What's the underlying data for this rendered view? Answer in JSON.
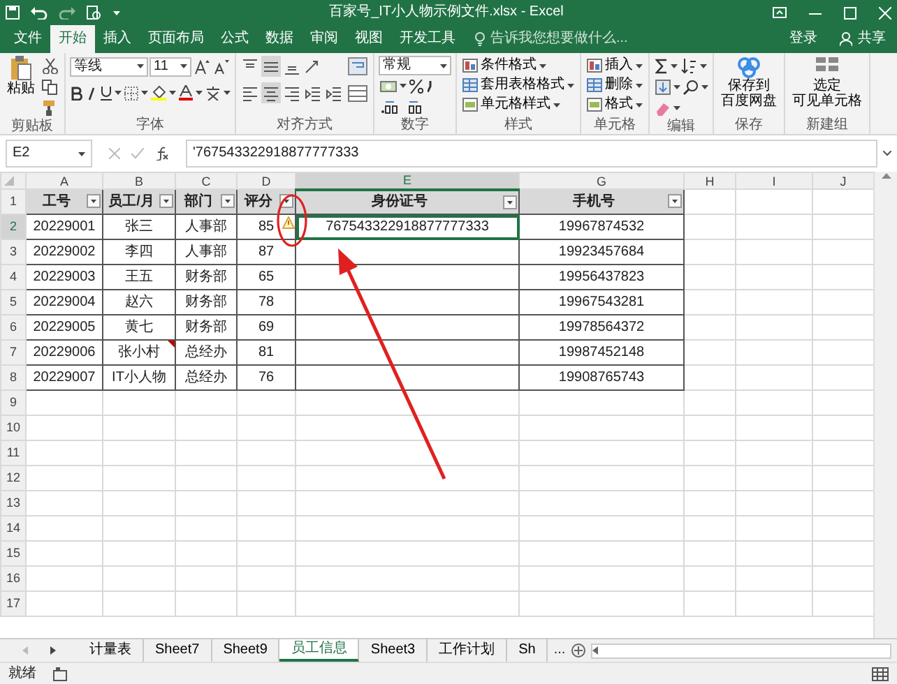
{
  "window": {
    "title": "百家号_IT小人物示例文件.xlsx - Excel"
  },
  "ribbon_tabs": [
    {
      "label": "文件",
      "selected": false
    },
    {
      "label": "开始",
      "selected": true
    },
    {
      "label": "插入",
      "selected": false
    },
    {
      "label": "页面布局",
      "selected": false
    },
    {
      "label": "公式",
      "selected": false
    },
    {
      "label": "数据",
      "selected": false
    },
    {
      "label": "审阅",
      "selected": false
    },
    {
      "label": "视图",
      "selected": false
    },
    {
      "label": "开发工具",
      "selected": false
    }
  ],
  "tell_me": {
    "placeholder": "告诉我您想要做什么..."
  },
  "account": {
    "login": "登录",
    "share": "共享"
  },
  "ribbon_groups": [
    {
      "label": "剪贴板",
      "kind": "clipboard",
      "paste": "粘贴"
    },
    {
      "label": "字体",
      "kind": "font",
      "font_name": "等线",
      "font_size": "11"
    },
    {
      "label": "对齐方式",
      "kind": "align",
      "buttons": [
        {
          "kind": "top",
          "selected": false
        },
        {
          "kind": "middle",
          "selected": true
        },
        {
          "kind": "bottom",
          "selected": false
        },
        {
          "kind": "orient",
          "selected": false
        },
        {
          "kind": "left",
          "selected": false
        },
        {
          "kind": "center",
          "selected": true
        },
        {
          "kind": "right",
          "selected": false
        },
        {
          "kind": "outdent",
          "selected": false
        },
        {
          "kind": "indent",
          "selected": false
        }
      ]
    },
    {
      "label": "数字",
      "kind": "number",
      "format": "常规"
    },
    {
      "label": "样式",
      "kind": "list",
      "items": [
        "条件格式",
        "套用表格格式",
        "单元格样式"
      ]
    },
    {
      "label": "单元格",
      "kind": "list",
      "items": [
        "插入",
        "删除",
        "格式"
      ]
    },
    {
      "label": "编辑",
      "kind": "edit"
    },
    {
      "label": "保存",
      "kind": "big",
      "lines": [
        "保存到",
        "百度网盘"
      ]
    },
    {
      "label": "新建组",
      "kind": "big",
      "lines": [
        "选定",
        "可见单元格"
      ]
    }
  ],
  "formula_bar": {
    "name_box": "E2",
    "formula": "'767543322918877777333"
  },
  "columns": [
    {
      "letter": "A",
      "selected": false
    },
    {
      "letter": "B",
      "selected": false
    },
    {
      "letter": "C",
      "selected": false
    },
    {
      "letter": "D",
      "selected": false
    },
    {
      "letter": "E",
      "selected": true
    },
    {
      "letter": "G",
      "selected": false
    },
    {
      "letter": "H",
      "selected": false
    },
    {
      "letter": "I",
      "selected": false
    },
    {
      "letter": "J",
      "selected": false
    }
  ],
  "row_numbers": [
    {
      "label": "1",
      "selected": false
    },
    {
      "label": "2",
      "selected": true
    },
    {
      "label": "3",
      "selected": false
    },
    {
      "label": "4",
      "selected": false
    },
    {
      "label": "5",
      "selected": false
    },
    {
      "label": "6",
      "selected": false
    },
    {
      "label": "7",
      "selected": false
    },
    {
      "label": "8",
      "selected": false
    },
    {
      "label": "9",
      "selected": false
    },
    {
      "label": "10",
      "selected": false
    },
    {
      "label": "11",
      "selected": false
    },
    {
      "label": "12",
      "selected": false
    },
    {
      "label": "13",
      "selected": false
    },
    {
      "label": "14",
      "selected": false
    },
    {
      "label": "15",
      "selected": false
    },
    {
      "label": "16",
      "selected": false
    },
    {
      "label": "17",
      "selected": false
    }
  ],
  "table": {
    "header": [
      "工号",
      "员工/月",
      "部门",
      "评分",
      "身份证号",
      "手机号"
    ],
    "rows": [
      [
        {
          "text": "20229001"
        },
        {
          "text": "张三"
        },
        {
          "text": "人事部"
        },
        {
          "text": "85",
          "warning": true
        },
        {
          "text": "767543322918877777333",
          "selected": true
        },
        {
          "text": "19967874532"
        }
      ],
      [
        {
          "text": "20229002"
        },
        {
          "text": "李四"
        },
        {
          "text": "人事部"
        },
        {
          "text": "87"
        },
        {
          "text": ""
        },
        {
          "text": "19923457684"
        }
      ],
      [
        {
          "text": "20229003"
        },
        {
          "text": "王五"
        },
        {
          "text": "财务部"
        },
        {
          "text": "65"
        },
        {
          "text": ""
        },
        {
          "text": "19956437823"
        }
      ],
      [
        {
          "text": "20229004"
        },
        {
          "text": "赵六"
        },
        {
          "text": "财务部"
        },
        {
          "text": "78"
        },
        {
          "text": ""
        },
        {
          "text": "19967543281"
        }
      ],
      [
        {
          "text": "20229005"
        },
        {
          "text": "黄七"
        },
        {
          "text": "财务部"
        },
        {
          "text": "69"
        },
        {
          "text": ""
        },
        {
          "text": "19978564372"
        }
      ],
      [
        {
          "text": "20229006"
        },
        {
          "text": "张小村",
          "comment": true
        },
        {
          "text": "总经办"
        },
        {
          "text": "81"
        },
        {
          "text": ""
        },
        {
          "text": "19987452148"
        }
      ],
      [
        {
          "text": "20229007"
        },
        {
          "text": "IT小人物"
        },
        {
          "text": "总经办"
        },
        {
          "text": "76"
        },
        {
          "text": ""
        },
        {
          "text": "19908765743"
        }
      ]
    ]
  },
  "sheet_tabs": [
    {
      "label": "计量表",
      "selected": false
    },
    {
      "label": "Sheet7",
      "selected": false
    },
    {
      "label": "Sheet9",
      "selected": false
    },
    {
      "label": "员工信息",
      "selected": true
    },
    {
      "label": "Sheet3",
      "selected": false
    },
    {
      "label": "工作计划",
      "selected": false
    },
    {
      "label": "Sh",
      "selected": false
    }
  ],
  "more_sheets": "...",
  "status_bar": {
    "ready": "就绪"
  }
}
